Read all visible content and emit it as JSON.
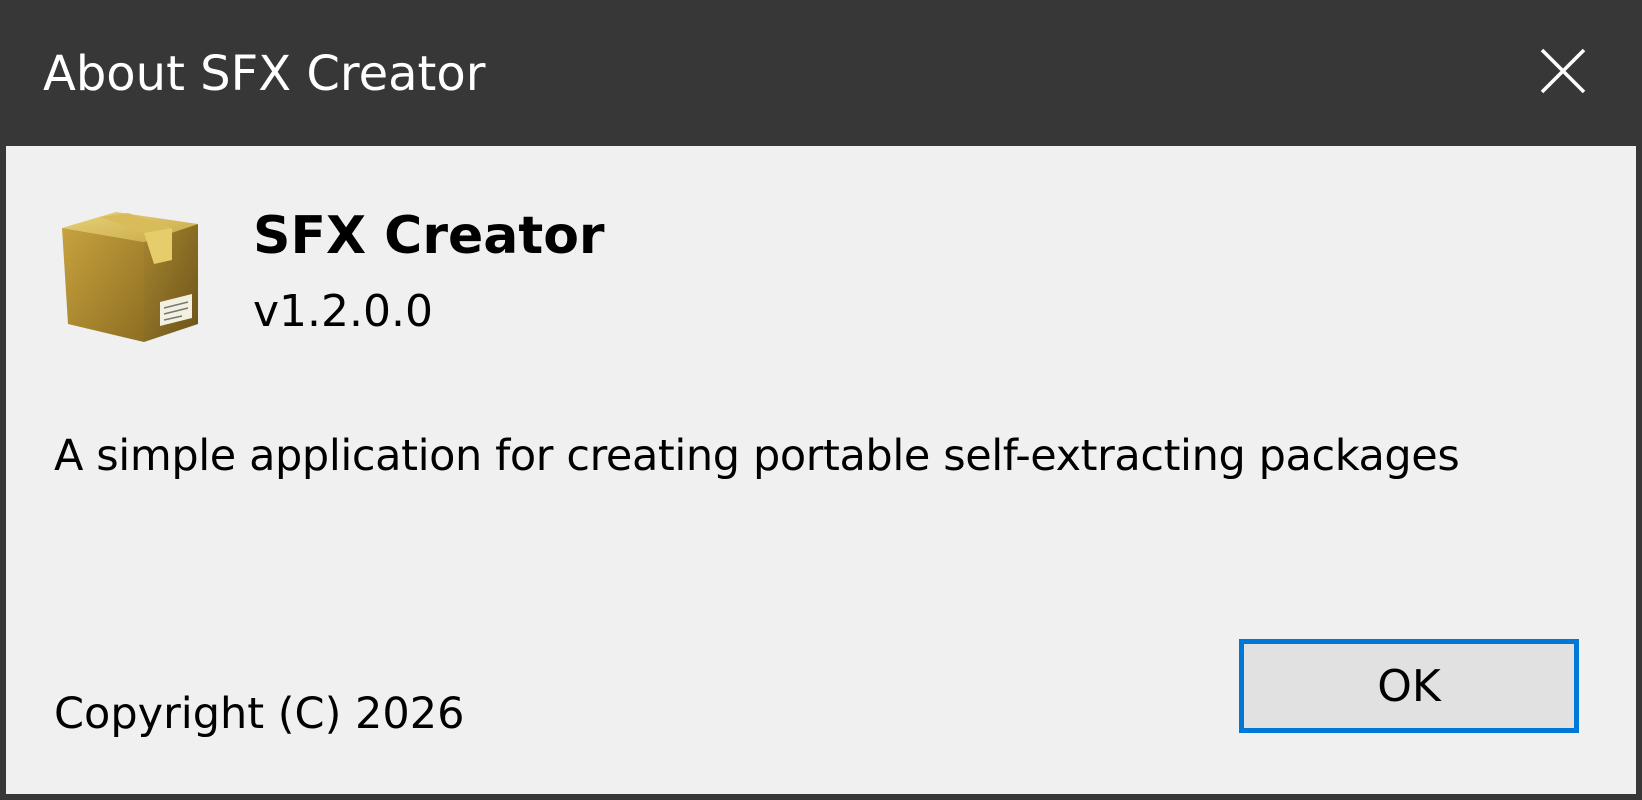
{
  "window": {
    "title": "About SFX Creator",
    "close_icon": "close-icon"
  },
  "app": {
    "icon": "package-box-icon",
    "name": "SFX Creator",
    "version": "v1.2.0.0",
    "description": "A simple application for creating portable self-extracting packages",
    "copyright": "Copyright (C) 2026"
  },
  "buttons": {
    "ok_label": "OK"
  },
  "colors": {
    "titlebar": "#373737",
    "client_bg": "#f0f0f0",
    "focus_border": "#0078d7",
    "button_bg": "#e1e1e1"
  }
}
